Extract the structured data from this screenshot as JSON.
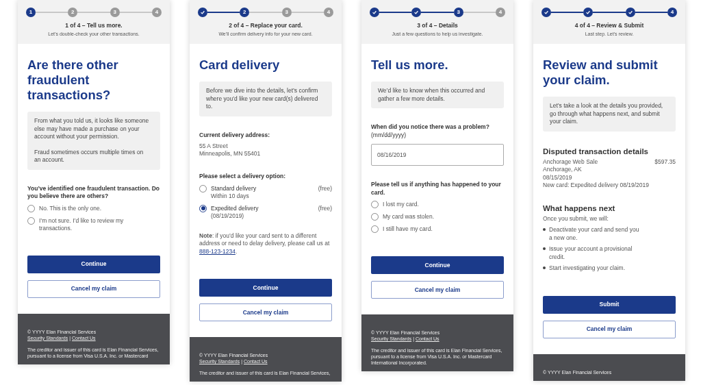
{
  "screens": [
    {
      "steps": [
        {
          "label": "1",
          "done": false,
          "current": true
        },
        {
          "label": "2",
          "done": false,
          "current": false
        },
        {
          "label": "3",
          "done": false,
          "current": false
        },
        {
          "label": "4",
          "done": false,
          "current": false
        }
      ],
      "step_title": "1 of 4 – Tell us more.",
      "step_subtitle": "Let’s double-check your other transactions.",
      "heading": "Are there other fraudulent transactions?",
      "intro": [
        "From what you told us, it looks like someone else may have made a purchase on your account without your permission.",
        "Fraud sometimes occurs multiple times on an account."
      ],
      "sections": [
        {
          "kind": "radio_group",
          "question": "**You’ve identified one fraudulent transaction. Do you believe there are others?**",
          "options": [
            {
              "label": "No. This is the only one.",
              "selected": false
            },
            {
              "label": "I’m not sure. I’d like to review my transactions.",
              "selected": false
            }
          ]
        }
      ],
      "buttons": [
        {
          "label": "Continue",
          "kind": "primary"
        },
        {
          "label": "Cancel my claim",
          "kind": "secondary"
        }
      ],
      "footer": {
        "copyright": "© YYYY Elan Financial Services",
        "links": [
          "Security Standards",
          "Contact Us"
        ],
        "separator": "|",
        "disclaimer": "The creditor and issuer of this card is Elan Financial Services, pursuant to a license from Visa U.S.A. Inc. or Mastercard"
      }
    },
    {
      "steps": [
        {
          "done": true
        },
        {
          "label": "2",
          "done": false,
          "current": true
        },
        {
          "label": "3",
          "done": false,
          "current": false
        },
        {
          "label": "4",
          "done": false,
          "current": false
        }
      ],
      "step_title": "2 of 4 – Replace your card.",
      "step_subtitle": "We’ll confirm delivery info for your new card.",
      "heading": "Card delivery",
      "intro": [
        "Before we dive into the details, let’s confirm where you’d like your new card(s) delivered to."
      ],
      "sections": [
        {
          "kind": "address",
          "label": "Current delivery address:",
          "lines": [
            "55 A Street",
            "Minneapolis, MN 55401"
          ]
        },
        {
          "kind": "radio_group",
          "question": "**Please select a delivery option:**",
          "options": [
            {
              "label": "Standard delivery",
              "detail": "Within 10 days",
              "price": "(free)",
              "selected": false
            },
            {
              "label": "Expedited delivery",
              "detail": "(08/19/2019)",
              "price": "(free)",
              "selected": true
            }
          ]
        },
        {
          "kind": "note",
          "text": "**Note**: if you’d like your card sent to a different address or need to delay delivery, please call us at",
          "link": "888-123-1234",
          "after": "."
        }
      ],
      "buttons": [
        {
          "label": "Continue",
          "kind": "primary"
        },
        {
          "label": "Cancel my claim",
          "kind": "secondary"
        }
      ],
      "footer": {
        "copyright": "© YYYY Elan Financial Services",
        "links": [
          "Security Standards",
          "Contact Us"
        ],
        "separator": "|",
        "disclaimer": "The creditor and issuer of this card is Elan Financial Services,"
      }
    },
    {
      "steps": [
        {
          "done": true
        },
        {
          "done": true
        },
        {
          "label": "3",
          "done": false,
          "current": true
        },
        {
          "label": "4",
          "done": false,
          "current": false
        }
      ],
      "step_title": "3 of 4 – Details",
      "step_subtitle": "Just a few questions to help us investigate.",
      "heading": "Tell us more.",
      "intro": [
        "We’d like to know when this occurred and gather a few more details."
      ],
      "sections": [
        {
          "kind": "date_field",
          "question": "**When did you notice there was a problem?** (mm/dd/yyyy)",
          "value": "08/16/2019"
        },
        {
          "kind": "radio_group",
          "question": "**Please tell us if anything has happened to your card.**",
          "options": [
            {
              "label": "I lost my card.",
              "selected": false
            },
            {
              "label": "My card was stolen.",
              "selected": false
            },
            {
              "label": "I still have my card.",
              "selected": false
            }
          ]
        }
      ],
      "buttons": [
        {
          "label": "Continue",
          "kind": "primary"
        },
        {
          "label": "Cancel my claim",
          "kind": "secondary"
        }
      ],
      "footer": {
        "copyright": "© YYYY Elan Financial Services",
        "links": [
          "Security Standards",
          "Contact Us"
        ],
        "separator": "|",
        "disclaimer": "The creditor and issuer of this card is Elan Financial Services, pursuant to a license from Visa U.S.A. Inc. or Mastercard International Incorporated."
      }
    },
    {
      "steps": [
        {
          "done": true
        },
        {
          "done": true
        },
        {
          "done": true
        },
        {
          "label": "4",
          "done": false,
          "current": true
        }
      ],
      "step_title": "4 of 4 – Review & Submit",
      "step_subtitle": "Last step. Let’s review.",
      "heading": "Review and submit your claim.",
      "intro": [
        "Let’s take a look at the details you provided, go through what happens next, and submit your claim."
      ],
      "sections": [
        {
          "kind": "details",
          "heading": "Disputed transaction details",
          "rows": [
            {
              "text": "Anchorage Web Sale",
              "amount": "$597.35"
            },
            {
              "text": "Anchorage, AK"
            },
            {
              "text": "08/15/2019"
            },
            {
              "text": "New card: Expedited delivery 08/19/2019"
            }
          ]
        },
        {
          "kind": "list",
          "heading": "What happens next",
          "intro": "Once you submit, we will:",
          "items": [
            "Deactivate your card and send you a new one.",
            "Issue your account a provisional credit.",
            "Start investigating your claim."
          ]
        }
      ],
      "buttons": [
        {
          "label": "Submit",
          "kind": "primary"
        },
        {
          "label": "Cancel my claim",
          "kind": "secondary"
        }
      ],
      "footer": {
        "copyright": "© YYYY Elan Financial Services"
      }
    }
  ]
}
